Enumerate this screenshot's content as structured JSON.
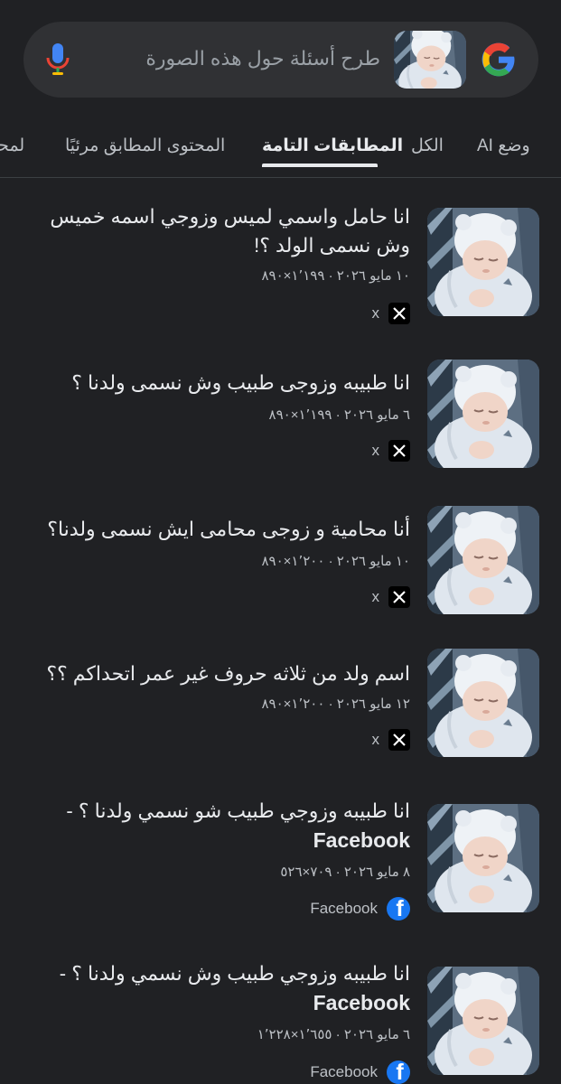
{
  "search": {
    "placeholder": "طرح أسئلة حول هذه الصورة"
  },
  "tabs": [
    {
      "label": "وضع AI",
      "active": false
    },
    {
      "label": "الكل",
      "active": false
    },
    {
      "label": "المطابقات التامة",
      "active": true
    },
    {
      "label": "المحتوى المطابق مرئيًا",
      "active": false
    },
    {
      "label": "لمحة",
      "active": false
    }
  ],
  "results": [
    {
      "title": "انا حامل واسمي لميس وزوجي اسمه خميس وش نسمى الولد ؟!",
      "title_suffix": "",
      "meta": "١٠ مايو ٢٠٢٦ · ١٬١٩٩×٨٩٠",
      "source": "x",
      "source_icon": "x-logo-icon"
    },
    {
      "title": "انا طبيبه وزوجى طبيب وش نسمى ولدنا ؟",
      "title_suffix": "",
      "meta": "٦ مايو ٢٠٢٦ · ١٬١٩٩×٨٩٠",
      "source": "x",
      "source_icon": "x-logo-icon"
    },
    {
      "title": "أنا محامية و زوجى محامى ايش نسمى ولدنا؟",
      "title_suffix": "",
      "meta": "١٠ مايو ٢٠٢٦ · ١٬٢٠٠×٨٩٠",
      "source": "x",
      "source_icon": "x-logo-icon"
    },
    {
      "title": "اسم ولد من ثلاثه حروف غير عمر اتحداكم ؟؟",
      "title_suffix": "",
      "meta": "١٢ مايو ٢٠٢٦ · ١٬٢٠٠×٨٩٠",
      "source": "x",
      "source_icon": "x-logo-icon"
    },
    {
      "title": "انا طبيبه وزوجي طبيب شو نسمي ولدنا ؟ -",
      "title_suffix": "Facebook",
      "meta": "٨ مايو ٢٠٢٦ · ٧٠٩×٥٢٦",
      "source": "Facebook",
      "source_icon": "facebook-logo-icon"
    },
    {
      "title": "انا طبيبه وزوجي طبيب وش نسمي ولدنا ؟ -",
      "title_suffix": "Facebook",
      "meta": "٦ مايو ٢٠٢٦ · ١٬٦٥٥×١٬٢٢٨",
      "source": "Facebook",
      "source_icon": "facebook-logo-icon"
    }
  ],
  "colors": {
    "background": "#202124",
    "searchbar": "#303134",
    "text": "#e8eaed",
    "muted": "#bdc1c6",
    "facebook": "#1877f2"
  }
}
